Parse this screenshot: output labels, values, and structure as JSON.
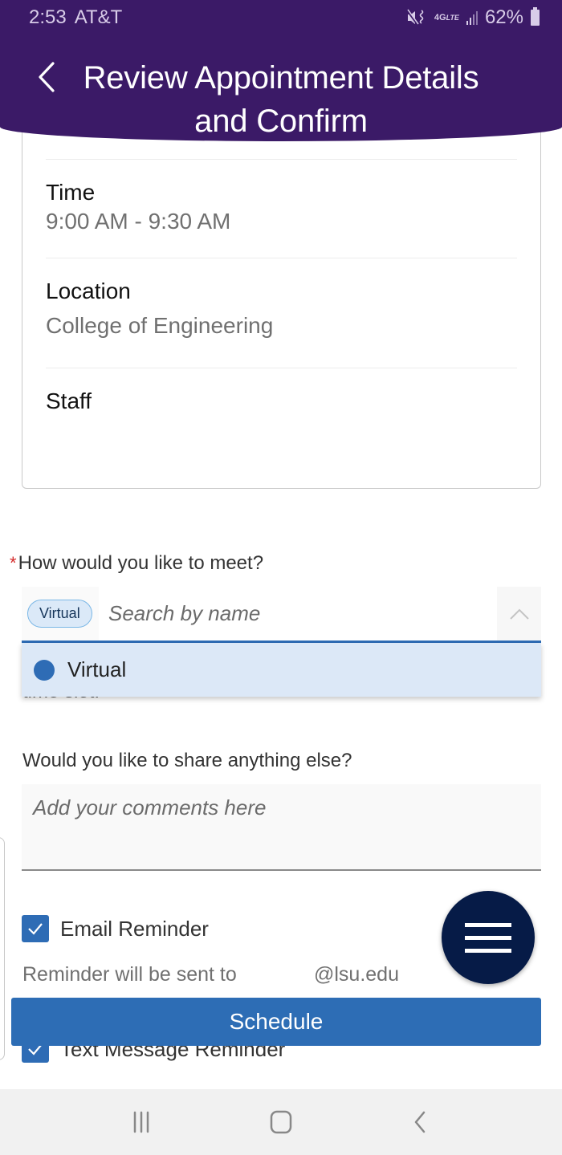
{
  "status_bar": {
    "time": "2:53",
    "carrier": "AT&T",
    "network": "4G",
    "network_sub": "LTE",
    "battery": "62%",
    "icons": [
      "mute-vibrate-icon",
      "4g-lte-icon",
      "signal-icon",
      "battery-icon"
    ]
  },
  "header": {
    "title": "Review Appointment Details and Confirm",
    "back_icon": "chevron-left-icon"
  },
  "details": {
    "time_label": "Time",
    "time_value": "9:00 AM - 9:30 AM",
    "location_label": "Location",
    "location_value": "College of Engineering",
    "staff_label": "Staff",
    "staff_value": ""
  },
  "meeting": {
    "required_marker": "*",
    "question": "How would you like to meet?",
    "selected_chip": "Virtual",
    "search_placeholder": "Search by name",
    "toggle_icon": "chevron-up-icon",
    "options": [
      {
        "label": "Virtual",
        "selected": true
      }
    ],
    "obscured_text": "time slot."
  },
  "comments": {
    "label": "Would you like to share anything else?",
    "placeholder": "Add your comments here",
    "value": ""
  },
  "reminders": {
    "email_label": "Email Reminder",
    "email_checked": true,
    "note": "Reminder will be sent to",
    "email_domain": "@lsu.edu",
    "text_label": "Text Message Reminder",
    "text_checked": true
  },
  "actions": {
    "schedule_label": "Schedule",
    "fab_icon": "hamburger-menu-icon"
  },
  "colors": {
    "brand_purple": "#3b1a67",
    "primary_blue": "#2d6db5",
    "fab_navy": "#061b47",
    "option_highlight": "#dce8f7",
    "required_red": "#d42b2b"
  },
  "nav_bar": {
    "recents_icon": "recent-apps-icon",
    "home_icon": "home-icon",
    "back_icon": "back-icon"
  }
}
